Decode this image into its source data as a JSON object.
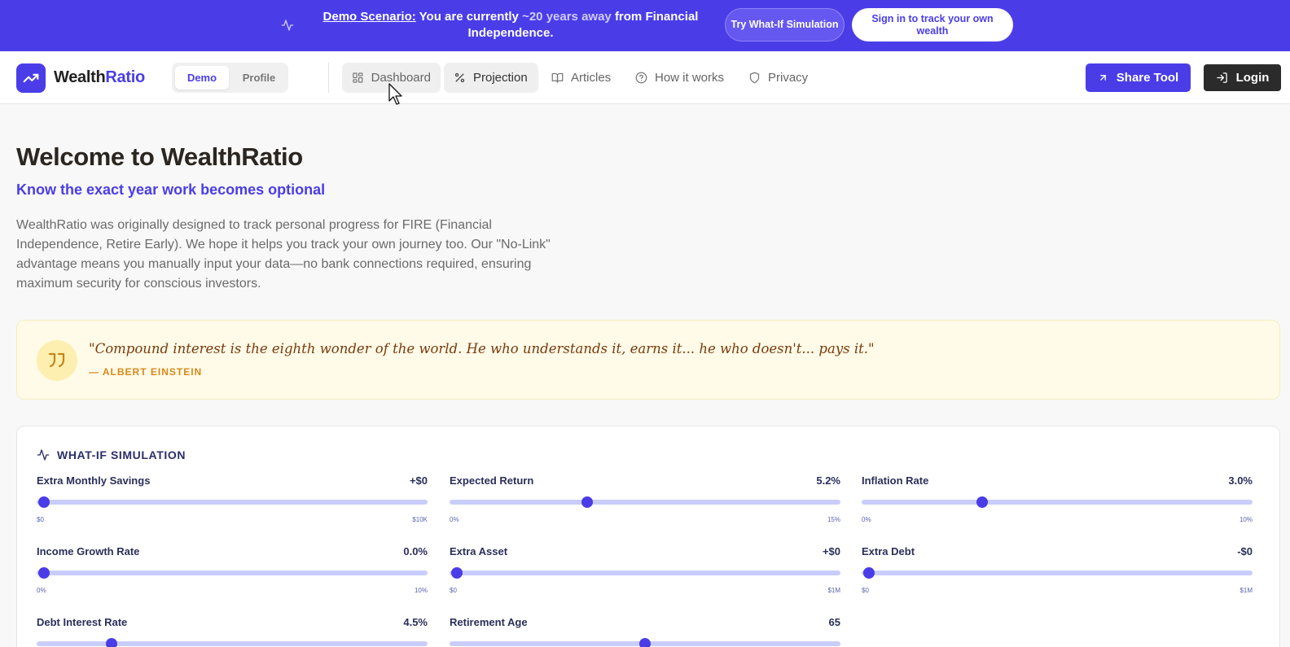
{
  "banner": {
    "icon": "activity-icon",
    "link_label": "Demo Scenario:",
    "text_before": "You are currently",
    "highlight": "~20 years away",
    "text_after": "from Financial Independence.",
    "whatif_button": "Try What-If Simulation",
    "signin_button": "Sign in to track your own wealth",
    "color": "#4a3de8"
  },
  "nav": {
    "logo_word": "Wealth",
    "logo_accent": "Ratio",
    "logo_icon": "trending-up-icon",
    "segments": {
      "demo": "Demo",
      "profile": "Profile"
    },
    "items": [
      {
        "label": "Dashboard",
        "icon": "grid-icon"
      },
      {
        "label": "Projection",
        "icon": "percent-icon"
      },
      {
        "label": "Articles",
        "icon": "book-icon"
      },
      {
        "label": "How it works",
        "icon": "help-circle-icon"
      },
      {
        "label": "Privacy",
        "icon": "shield-icon"
      }
    ],
    "share_label": "Share Tool",
    "login_label": "Login"
  },
  "hero": {
    "title": "Welcome to WealthRatio",
    "tagline": "Know the exact year work becomes optional",
    "intro": "WealthRatio was originally designed to track personal progress for FIRE (Financial Independence, Retire Early). We hope it helps you track your own journey too. Our \"No-Link\" advantage means you manually input your data—no bank connections required, ensuring maximum security for conscious investors."
  },
  "quote": {
    "text": "\"Compound interest is the eighth wonder of the world. He who understands it, earns it... he who doesn't... pays it.\"",
    "author": "— ALBERT EINSTEIN",
    "icon": "quote-icon"
  },
  "simulation": {
    "title": "WHAT-IF SIMULATION",
    "icon": "activity-icon",
    "sliders": [
      {
        "label": "Extra Monthly Savings",
        "value": "+$0",
        "min": "$0",
        "max": "$10K",
        "position": 0.0
      },
      {
        "label": "Expected Return",
        "value": "5.2%",
        "min": "0%",
        "max": "15%",
        "position": 0.347
      },
      {
        "label": "Inflation Rate",
        "value": "3.0%",
        "min": "0%",
        "max": "10%",
        "position": 0.3
      },
      {
        "label": "Income Growth Rate",
        "value": "0.0%",
        "min": "0%",
        "max": "10%",
        "position": 0.0
      },
      {
        "label": "Extra Asset",
        "value": "+$0",
        "min": "$0",
        "max": "$1M",
        "position": 0.0
      },
      {
        "label": "Extra Debt",
        "value": "-$0",
        "min": "$0",
        "max": "$1M",
        "position": 0.0
      },
      {
        "label": "Debt Interest Rate",
        "value": "4.5%",
        "min": "",
        "max": "",
        "position": 0.18
      },
      {
        "label": "Retirement Age",
        "value": "65",
        "min": "",
        "max": "",
        "position": 0.5
      }
    ]
  }
}
